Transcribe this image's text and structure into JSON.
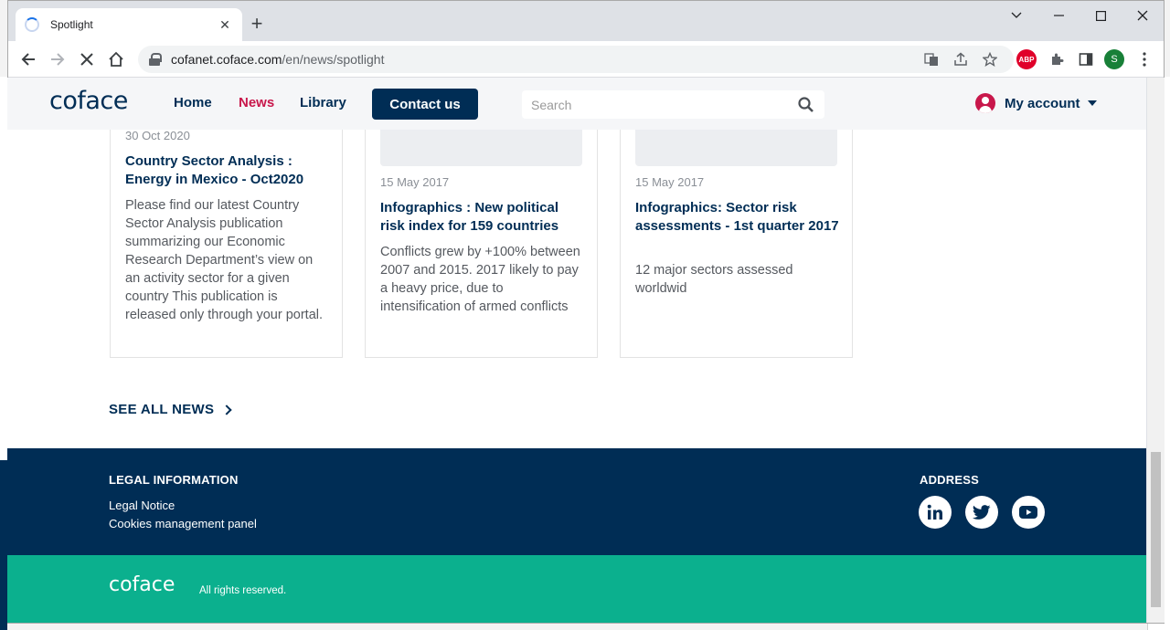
{
  "browser": {
    "tab_title": "Spotlight",
    "url_host": "cofanet.coface.com",
    "url_path": "/en/news/spotlight",
    "profile_initial": "S",
    "adblock_label": "ABP"
  },
  "site": {
    "logo": "coface",
    "nav": {
      "home": "Home",
      "news": "News",
      "library": "Library",
      "contact": "Contact us"
    },
    "search_placeholder": "Search",
    "account_label": "My account"
  },
  "cards": [
    {
      "date": "30 Oct 2020",
      "title": "Country Sector Analysis : Energy in Mexico - Oct2020",
      "description": "Please find our latest Country Sector Analysis publication summarizing our Economic Research Department’s view on an activity sector for a given country This publication is released only through your portal."
    },
    {
      "date": "15 May 2017",
      "title": "Infographics : New political risk index for 159 countries",
      "description": "Conflicts grew by +100% between 2007 and 2015. 2017 likely to pay a heavy price, due to intensification of armed conflicts"
    },
    {
      "date": "15 May 2017",
      "title": "Infographics: Sector risk assessments - 1st quarter 2017",
      "description": "12 major sectors assessed worldwid"
    }
  ],
  "see_all_news": "SEE ALL NEWS",
  "footer": {
    "legal_heading": "LEGAL INFORMATION",
    "legal_notice": "Legal Notice",
    "cookies": "Cookies management panel",
    "address_heading": "ADDRESS",
    "logo": "coface",
    "rights": "All rights reserved."
  },
  "colors": {
    "navy": "#002d55",
    "accent_red": "#c8174b",
    "footer_green": "#0bb08e"
  },
  "icons": [
    "spinner-icon",
    "close-icon",
    "new-tab-icon",
    "back-icon",
    "forward-icon",
    "stop-icon",
    "home-icon",
    "lock-icon",
    "translate-icon",
    "share-icon",
    "star-icon",
    "extensions-icon",
    "sidebar-icon",
    "menu-icon",
    "search-icon",
    "user-icon",
    "linkedin-icon",
    "twitter-icon",
    "youtube-icon"
  ]
}
